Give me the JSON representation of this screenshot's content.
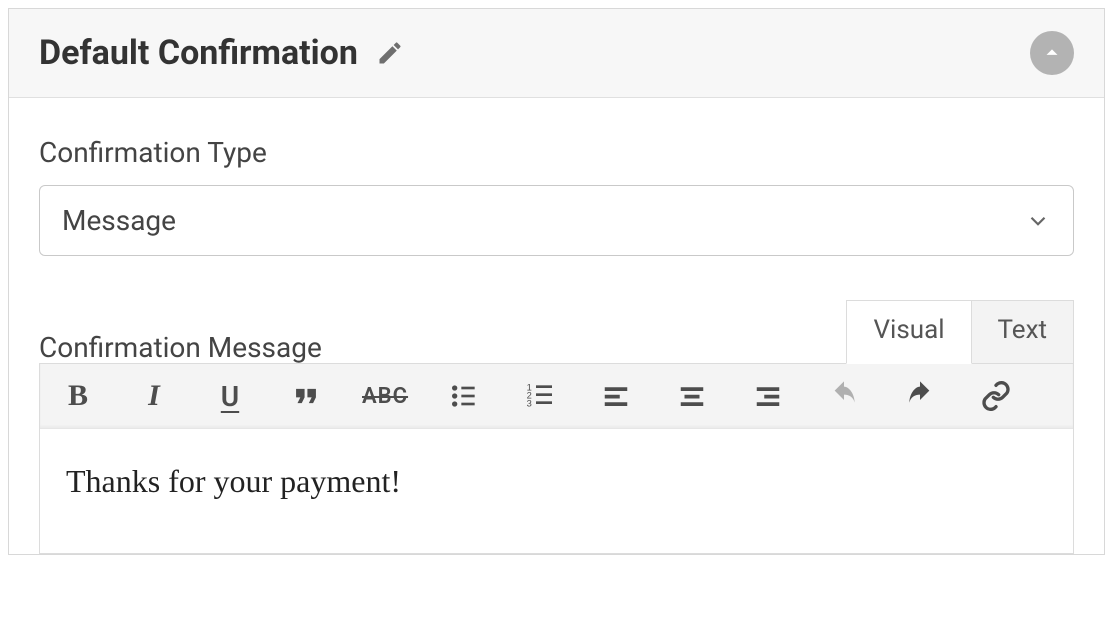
{
  "panel": {
    "title": "Default Confirmation"
  },
  "fields": {
    "type_label": "Confirmation Type",
    "type_value": "Message",
    "message_label": "Confirmation Message"
  },
  "editor": {
    "tabs": {
      "visual": "Visual",
      "text": "Text"
    },
    "content": "Thanks for your payment!",
    "toolbar": {
      "strike_glyph": "ABC"
    }
  }
}
